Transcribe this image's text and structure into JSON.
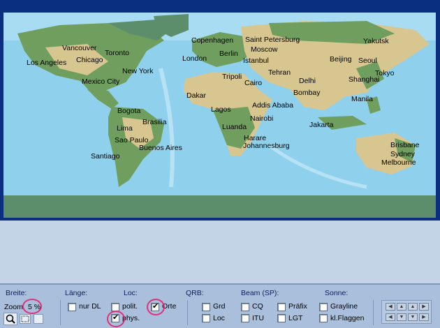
{
  "map": {
    "cities": [
      {
        "id": "vancouver",
        "label": "Vancouver"
      },
      {
        "id": "toronto",
        "label": "Toronto"
      },
      {
        "id": "chicago",
        "label": "Chicago"
      },
      {
        "id": "los-angeles",
        "label": "Los Angeles"
      },
      {
        "id": "new-york",
        "label": "New York"
      },
      {
        "id": "mexico-city",
        "label": "Mexico City"
      },
      {
        "id": "bogota",
        "label": "Bogota"
      },
      {
        "id": "lima",
        "label": "Lima"
      },
      {
        "id": "brasilia",
        "label": "Brasilia"
      },
      {
        "id": "sao-paulo",
        "label": "Sao Paulo"
      },
      {
        "id": "buenos-aires",
        "label": "Buenos Aires"
      },
      {
        "id": "santiago",
        "label": "Santiago"
      },
      {
        "id": "copenhagen",
        "label": "Copenhagen"
      },
      {
        "id": "saint-petersburg",
        "label": "Saint Petersburg"
      },
      {
        "id": "berlin",
        "label": "Berlin"
      },
      {
        "id": "moscow",
        "label": "Moscow"
      },
      {
        "id": "london",
        "label": "London"
      },
      {
        "id": "istanbul",
        "label": "Istanbul"
      },
      {
        "id": "tripoli",
        "label": "Tripoli"
      },
      {
        "id": "cairo",
        "label": "Cairo"
      },
      {
        "id": "tehran",
        "label": "Tehran"
      },
      {
        "id": "delhi",
        "label": "Delhi"
      },
      {
        "id": "bombay",
        "label": "Bombay"
      },
      {
        "id": "dakar",
        "label": "Dakar"
      },
      {
        "id": "addis-ababa",
        "label": "Addis Ababa"
      },
      {
        "id": "lagos",
        "label": "Lagos"
      },
      {
        "id": "nairobi",
        "label": "Nairobi"
      },
      {
        "id": "luanda",
        "label": "Luanda"
      },
      {
        "id": "harare",
        "label": "Harare"
      },
      {
        "id": "johannesburg",
        "label": "Johannesburg"
      },
      {
        "id": "yakutsk",
        "label": "Yakutsk"
      },
      {
        "id": "beijing",
        "label": "Beijing"
      },
      {
        "id": "seoul",
        "label": "Seoul"
      },
      {
        "id": "tokyo",
        "label": "Tokyo"
      },
      {
        "id": "shanghai",
        "label": "Shanghai"
      },
      {
        "id": "manila",
        "label": "Manila"
      },
      {
        "id": "jakarta",
        "label": "Jakarta"
      },
      {
        "id": "brisbane",
        "label": "Brisbane"
      },
      {
        "id": "sydney",
        "label": "Sydney"
      },
      {
        "id": "melbourne",
        "label": "Melbourne"
      }
    ]
  },
  "panel": {
    "headers": {
      "breite": "Breite:",
      "laenge": "Länge:",
      "loc": "Loc:",
      "qrb": "QRB:",
      "beam": "Beam (SP):",
      "sonne": "Sonne:"
    },
    "zoom": {
      "label": "Zoom",
      "value": "5 %"
    },
    "options": {
      "nur_dl": {
        "label": "nur DL",
        "checked": false
      },
      "polit": {
        "label": "polit.",
        "checked": false
      },
      "phys": {
        "label": "phys.",
        "checked": true
      },
      "orte": {
        "label": "Orte",
        "checked": true
      },
      "grd": {
        "label": "Grd",
        "checked": false
      },
      "loc": {
        "label": "Loc",
        "checked": false
      },
      "cq": {
        "label": "CQ",
        "checked": false
      },
      "itu": {
        "label": "ITU",
        "checked": false
      },
      "praefix": {
        "label": "Präfix",
        "checked": false
      },
      "lgt": {
        "label": "LGT",
        "checked": false
      },
      "grayline": {
        "label": "Grayline",
        "checked": false
      },
      "kl_flaggen": {
        "label": "kl.Flaggen",
        "checked": false
      }
    }
  },
  "colors": {
    "frame": "#0b2f80",
    "ocean": "#8fd0ec",
    "land_green": "#6f9e5e",
    "land_tan": "#d8c690",
    "ice": "#5d8e6b",
    "panel": "#a9bfdc",
    "highlight": "#e0307a"
  }
}
